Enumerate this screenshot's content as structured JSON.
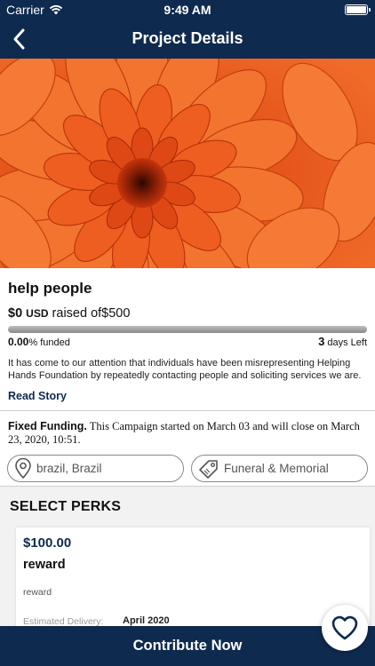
{
  "status_bar": {
    "carrier": "Carrier",
    "time": "9:49 AM"
  },
  "nav": {
    "title": "Project Details",
    "back_icon": "chevron-left-icon"
  },
  "hero": {
    "image": "orange-chrysanthemum-photo",
    "color": "#d8400f"
  },
  "project": {
    "title": "help people",
    "raised_amount": "$0",
    "raised_currency": "USD",
    "raised_text": "raised of",
    "goal": "$500",
    "funded_percent_value": "0.00",
    "funded_percent_label": "% funded",
    "funded_fraction": 0,
    "days_left_value": "3",
    "days_left_label": "days Left",
    "description": "It has come to our attention that individuals have been misrepresenting Helping Hands Foundation by repeatedly contacting people and soliciting services we are.",
    "read_story": "Read Story"
  },
  "funding": {
    "label": "Fixed Funding.",
    "text": "This Campaign started on March 03 and will close on March 23, 2020, 10:51."
  },
  "tags": {
    "location": "brazil, Brazil",
    "location_icon": "map-pin-icon",
    "category": "Funeral & Memorial",
    "category_icon": "tag-icon"
  },
  "perks": {
    "heading": "SELECT PERKS",
    "items": [
      {
        "price": "$100.00",
        "name": "reward",
        "description": "reward",
        "delivery_label": "Estimated Delivery:",
        "delivery_value": "April 2020"
      }
    ]
  },
  "contribute_label": "Contribute Now",
  "favorite_icon": "heart-icon",
  "colors": {
    "primary": "#0e2a4f",
    "background": "#ffffff",
    "perks_bg": "#f2f2f2"
  }
}
